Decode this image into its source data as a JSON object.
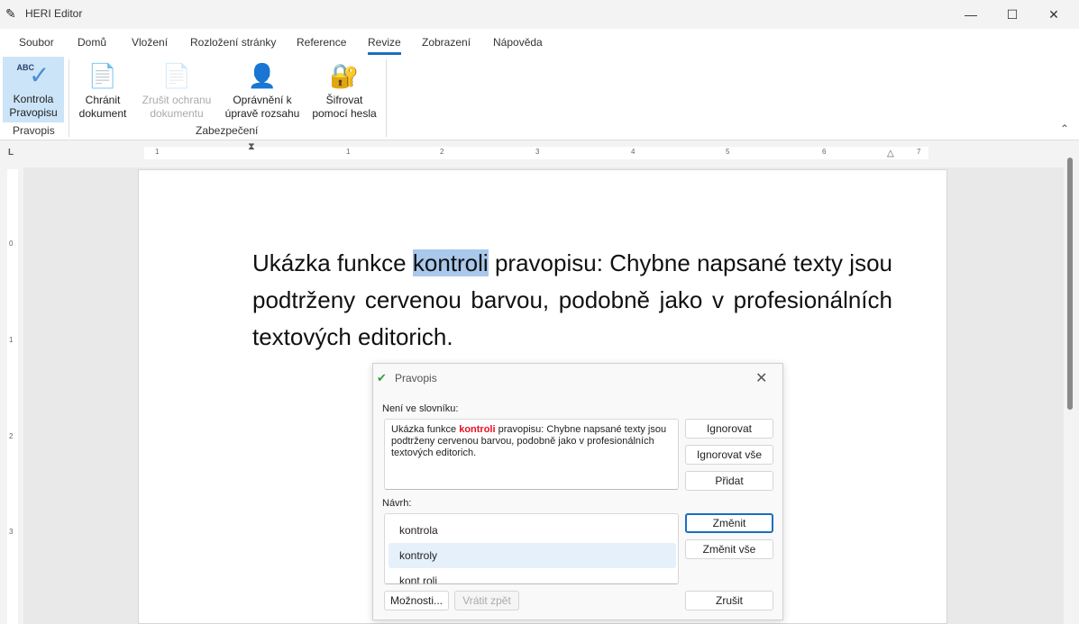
{
  "window": {
    "title": "HERI Editor",
    "minimize": "—",
    "maximize": "☐",
    "close": "✕"
  },
  "tabs": [
    "Soubor",
    "Domů",
    "Vložení",
    "Rozložení stránky",
    "Reference",
    "Revize",
    "Zobrazení",
    "Nápověda"
  ],
  "ribbon": {
    "spell": {
      "line1": "Kontrola",
      "line2": "Pravopisu",
      "icon_text": "ABC"
    },
    "protect": {
      "line1": "Chránit",
      "line2": "dokument"
    },
    "unprotect": {
      "line1": "Zrušit ochranu",
      "line2": "dokumentu"
    },
    "permissions": {
      "line1": "Oprávnění k",
      "line2": "úpravě rozsahu"
    },
    "encrypt": {
      "line1": "Šifrovat",
      "line2": "pomocí hesla"
    },
    "group_spell": "Pravopis",
    "group_security": "Zabezpečení"
  },
  "ruler": {
    "corner": "L",
    "h_labels": [
      "1",
      "1",
      "2",
      "3",
      "4",
      "5",
      "6",
      "7"
    ],
    "v_labels": [
      "0",
      "1",
      "2",
      "3"
    ]
  },
  "document": {
    "before": "Ukázka funkce ",
    "highlight": "kontroli",
    "after": " pravopisu: Chybne napsané texty jsou podtrženy cervenou barvou, podobně jako v profesionálních textových editorich."
  },
  "dialog": {
    "title": "Pravopis",
    "not_in_dict_label": "Není ve slovníku:",
    "context_before": "Ukázka funkce ",
    "context_word": "kontroli",
    "context_after": " pravopisu: Chybne napsané texty jsou podtrženy cervenou barvou, podobně jako v profesionálních textových editorich.",
    "suggest_label": "Návrh:",
    "suggestions": [
      "kontrola",
      "kontroly",
      "kont roli"
    ],
    "buttons": {
      "ignore": "Ignorovat",
      "ignore_all": "Ignorovat vše",
      "add": "Přidat",
      "change": "Změnit",
      "change_all": "Změnit vše",
      "options": "Možnosti...",
      "undo": "Vrátit zpět",
      "cancel": "Zrušit"
    },
    "error_color": "#e81123"
  }
}
